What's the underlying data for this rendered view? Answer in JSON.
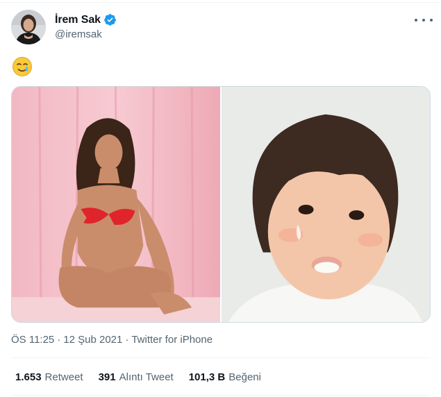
{
  "author": {
    "display_name": "İrem Sak",
    "handle": "@iremsak",
    "verified": true,
    "verified_color": "#1d9bf0"
  },
  "tweet": {
    "emoji_icon": "face-holding-back-tears-icon",
    "emoji_char": "🥲",
    "media": [
      {
        "icon": "photo-woman-posing-pink-background"
      },
      {
        "icon": "photo-toddler-crying-with-milk"
      }
    ]
  },
  "meta": {
    "time": "ÖS 11:25",
    "separator": "·",
    "date": "12 Şub 2021",
    "source": "Twitter for iPhone"
  },
  "stats": [
    {
      "count": "1.653",
      "label": "Retweet"
    },
    {
      "count": "391",
      "label": "Alıntı Tweet"
    },
    {
      "count": "101,3 B",
      "label": "Beğeni"
    }
  ],
  "colors": {
    "text_primary": "#0f1419",
    "text_secondary": "#536471",
    "border": "#eff3f4"
  }
}
